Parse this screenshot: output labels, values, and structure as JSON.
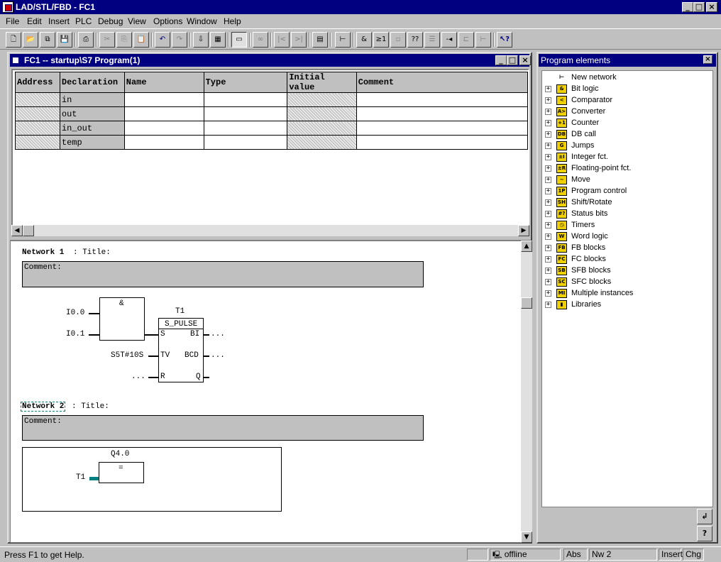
{
  "app": {
    "title": "LAD/STL/FBD  - FC1"
  },
  "menu": [
    "File",
    "Edit",
    "Insert",
    "PLC",
    "Debug",
    "View",
    "Options",
    "Window",
    "Help"
  ],
  "child": {
    "title": "FC1 -- startup\\S7 Program(1)"
  },
  "decl": {
    "headers": [
      "Address",
      "Declaration",
      "Name",
      "Type",
      "Initial value",
      "Comment"
    ],
    "rows": [
      "in",
      "out",
      "in_out",
      "temp"
    ]
  },
  "network1": {
    "label": "Network 1",
    "sep": ": Title:",
    "comment": "Comment:",
    "and_label": "&",
    "in1": "I0.0",
    "in2": "I0.1",
    "timer": "T1",
    "block": "S_PULSE",
    "pin_s": "S",
    "pin_tv": "TV",
    "pin_r": "R",
    "pin_bi": "BI",
    "pin_bcd": "BCD",
    "pin_q": "Q",
    "tv_val": "S5T#10S",
    "r_val": "...",
    "bi_out": "...",
    "bcd_out": "..."
  },
  "network2": {
    "label": "Network 2",
    "sep": ": Title:",
    "comment": "Comment:",
    "coil": "Q4.0",
    "assign": "=",
    "input": "T1"
  },
  "program_elements": {
    "title": "Program elements",
    "new_network": "New network",
    "items": [
      {
        "label": "Bit logic",
        "icon": "&"
      },
      {
        "label": "Comparator",
        "icon": "<"
      },
      {
        "label": "Converter",
        "icon": "A>"
      },
      {
        "label": "Counter",
        "icon": "+1"
      },
      {
        "label": "DB call",
        "icon": "DB"
      },
      {
        "label": "Jumps",
        "icon": "G"
      },
      {
        "label": "Integer fct.",
        "icon": "±I"
      },
      {
        "label": "Floating-point fct.",
        "icon": "±R"
      },
      {
        "label": "Move",
        "icon": "~"
      },
      {
        "label": "Program control",
        "icon": "1P"
      },
      {
        "label": "Shift/Rotate",
        "icon": "SH"
      },
      {
        "label": "Status bits",
        "icon": "#?"
      },
      {
        "label": "Timers",
        "icon": "◷"
      },
      {
        "label": "Word logic",
        "icon": "W"
      },
      {
        "label": "FB blocks",
        "icon": "FB"
      },
      {
        "label": "FC blocks",
        "icon": "FC"
      },
      {
        "label": "SFB blocks",
        "icon": "SB"
      },
      {
        "label": "SFC blocks",
        "icon": "SC"
      },
      {
        "label": "Multiple instances",
        "icon": "MI"
      },
      {
        "label": "Libraries",
        "icon": "▮"
      }
    ]
  },
  "status": {
    "help": "Press F1 to get Help.",
    "mode": "offline",
    "abs": "Abs",
    "nw": "Nw 2",
    "insert": "Insert",
    "chg": "Chg"
  }
}
